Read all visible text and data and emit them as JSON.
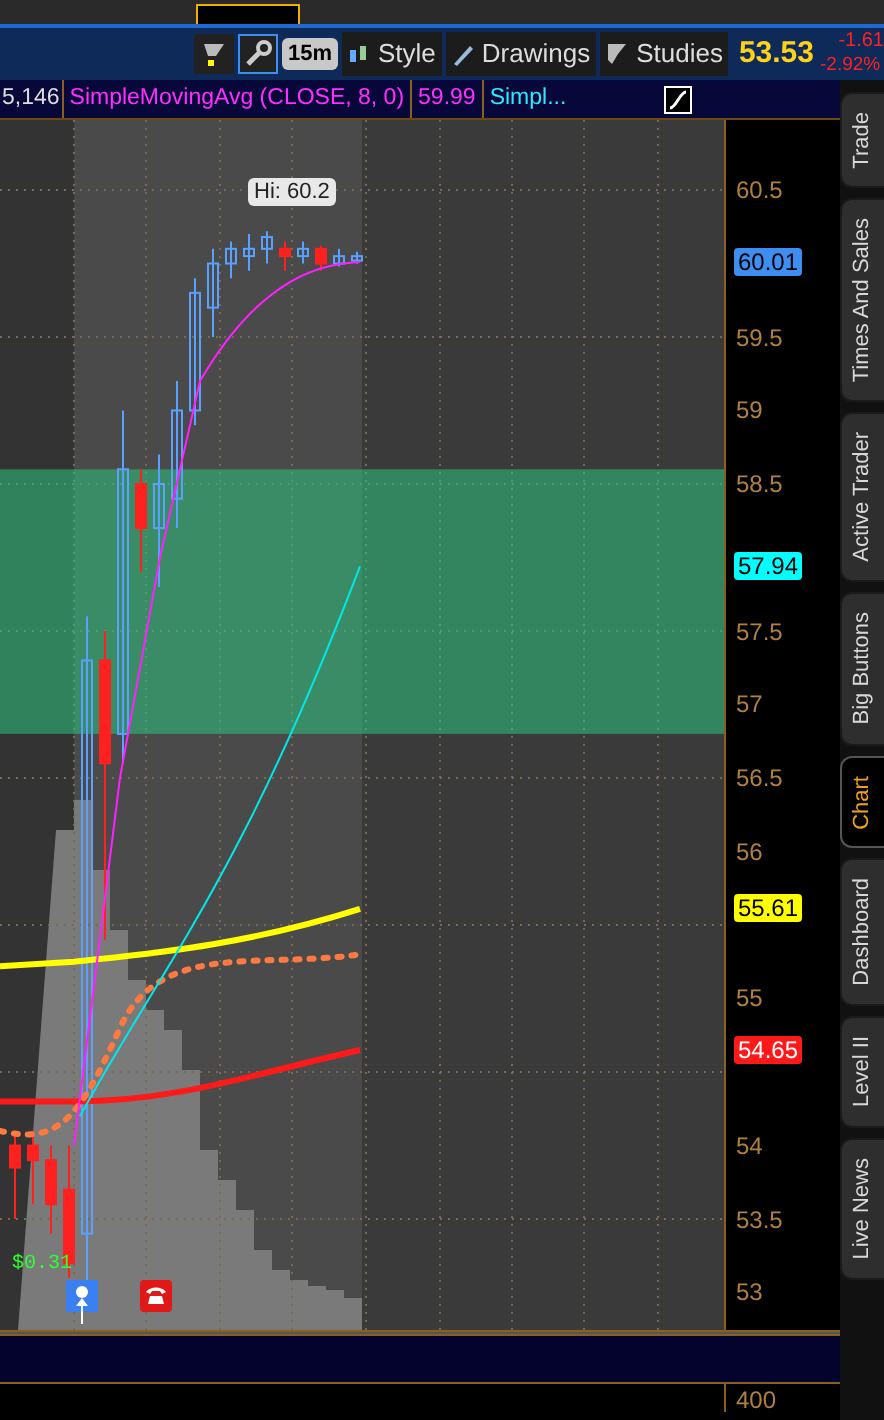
{
  "toolbar": {
    "interval": "15m",
    "buttons": [
      {
        "label": "Style"
      },
      {
        "label": "Drawings"
      },
      {
        "label": "Studies"
      }
    ],
    "last": "53.53",
    "change": "-1.61",
    "change_pct": "-2.92%"
  },
  "study_header": {
    "volume": "5,146",
    "study": "SimpleMovingAvg (CLOSE, 8, 0)",
    "study_value": "59.99",
    "next_study": "Simpl..."
  },
  "chart": {
    "high_bubble": "Hi: 60.2",
    "dividend": "$0.31",
    "price_labels": [
      {
        "label": "60.01",
        "color": "#3d8ef0"
      },
      {
        "label": "57.94",
        "color": "#00ffff"
      },
      {
        "label": "55.61",
        "color": "#ffff00"
      },
      {
        "label": "54.65",
        "color": "#ff1a1a"
      }
    ],
    "y_ticks": [
      "60.5",
      "59.5",
      "59",
      "58.5",
      "57.5",
      "57",
      "56.5",
      "56",
      "55",
      "54",
      "53.5",
      "53"
    ],
    "lower_tick": "400"
  },
  "side_tabs": [
    {
      "label": "Trade",
      "selected": false
    },
    {
      "label": "Times And Sales",
      "selected": false
    },
    {
      "label": "Active Trader",
      "selected": false
    },
    {
      "label": "Big Buttons",
      "selected": false
    },
    {
      "label": "Chart",
      "selected": true
    },
    {
      "label": "Dashboard",
      "selected": false
    },
    {
      "label": "Level II",
      "selected": false
    },
    {
      "label": "Live News",
      "selected": false
    }
  ]
}
